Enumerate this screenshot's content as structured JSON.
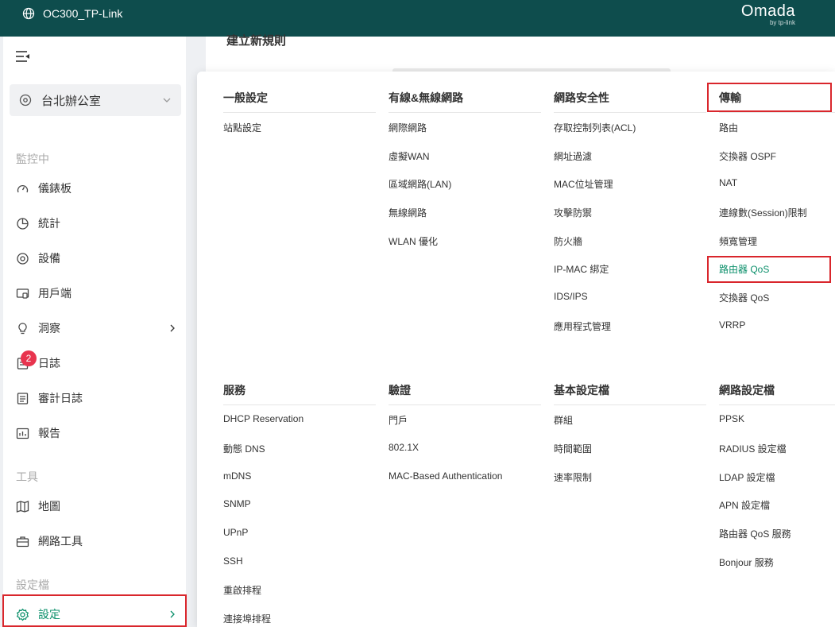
{
  "header": {
    "controller_name": "OC300_TP-Link",
    "brand_name": "Omada",
    "brand_sub": "by tp-link"
  },
  "sidebar": {
    "site": "台北辦公室",
    "sections": {
      "monitoring": "監控中",
      "tools": "工具",
      "profiles": "設定檔"
    },
    "items": [
      {
        "label": "儀錶板",
        "icon": "gauge-icon"
      },
      {
        "label": "統計",
        "icon": "pie-chart-icon"
      },
      {
        "label": "設備",
        "icon": "device-icon"
      },
      {
        "label": "用戶端",
        "icon": "client-icon"
      },
      {
        "label": "洞察",
        "icon": "lightbulb-icon"
      },
      {
        "label": "日誌",
        "icon": "log-icon",
        "badge": "2"
      },
      {
        "label": "審計日誌",
        "icon": "audit-log-icon"
      },
      {
        "label": "報告",
        "icon": "report-icon"
      },
      {
        "label": "地圖",
        "icon": "map-icon"
      },
      {
        "label": "網路工具",
        "icon": "toolbox-icon"
      },
      {
        "label": "設定",
        "icon": "gear-icon",
        "active": true
      }
    ]
  },
  "page": {
    "title": "建立新規則"
  },
  "menu": {
    "columns": [
      {
        "title": "一般設定",
        "items": [
          "站點設定"
        ]
      },
      {
        "title": "有線&無線網路",
        "items": [
          "網際網路",
          "虛擬WAN",
          "區域網路(LAN)",
          "無線網路",
          "WLAN 優化"
        ]
      },
      {
        "title": "網路安全性",
        "items": [
          "存取控制列表(ACL)",
          "網址過濾",
          "MAC位址管理",
          "攻擊防禦",
          "防火牆",
          "IP-MAC 綁定",
          "IDS/IPS",
          "應用程式管理"
        ]
      },
      {
        "title": "傳輸",
        "items": [
          "路由",
          "交換器 OSPF",
          "NAT",
          "連線數(Session)限制",
          "頻寬管理",
          "路由器 QoS",
          "交換器 QoS",
          "VRRP"
        ]
      },
      {
        "title": "服務",
        "items": [
          "DHCP Reservation",
          "動態 DNS",
          "mDNS",
          "SNMP",
          "UPnP",
          "SSH",
          "重啟排程",
          "連接埠排程"
        ]
      },
      {
        "title": "驗證",
        "items": [
          "門戶",
          "802.1X",
          "MAC-Based Authentication"
        ]
      },
      {
        "title": "基本設定檔",
        "items": [
          "群組",
          "時間範圍",
          "速率限制"
        ]
      },
      {
        "title": "網路設定檔",
        "items": [
          "PPSK",
          "RADIUS 設定檔",
          "LDAP 設定檔",
          "APN 設定檔",
          "路由器 QoS 服務",
          "Bonjour 服務"
        ]
      }
    ],
    "active_item": "路由器 QoS",
    "accent_color": "#0a8f6a"
  }
}
